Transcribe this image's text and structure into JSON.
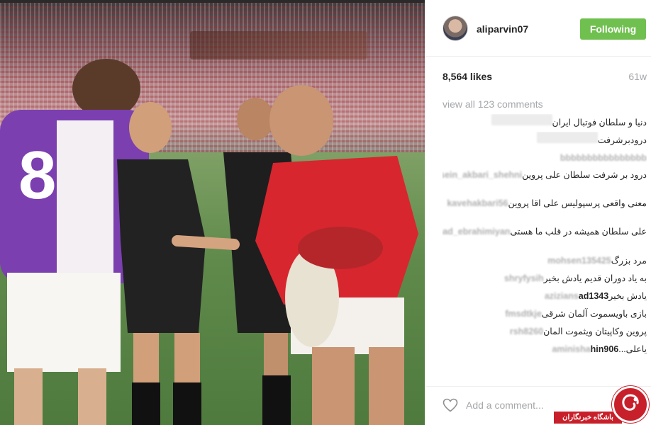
{
  "post": {
    "username": "aliparvin07",
    "follow_label": "Following",
    "likes": "8,564 likes",
    "age": "61w",
    "view_all": "view all 123 comments",
    "comment_placeholder": "Add a comment...",
    "photo_jersey_number": "8"
  },
  "comments": [
    {
      "user": "",
      "text": "دنیا و سلطان فوتبال ایران",
      "blank": true
    },
    {
      "user": "",
      "text": "درودبرشرفت",
      "blank": true
    },
    {
      "user": "bbbbbbbbbbbbbbbb",
      "text": "",
      "blank": false
    },
    {
      "user": "hossein_akbari_shehni",
      "text": "درود بر شرفت سلطان علی پروین",
      "two_line": true
    },
    {
      "user": "kavehakbari56",
      "text": "معنی واقعی پرسپولیس علی اقا پروین",
      "two_line": true
    },
    {
      "user": "mohamad_ebrahimiyan",
      "text": "علی سلطان همیشه در قلب ما هستی",
      "two_line": true
    },
    {
      "user": "mohsen135425",
      "text": "مرد بزرگ"
    },
    {
      "user": "shryfysih",
      "text": "به یاد دوران قدیم یادش بخیر"
    },
    {
      "user": "azizians",
      "user_clear": "ad1343",
      "text": "یادش بخیر"
    },
    {
      "user": "fmsdtkje",
      "text": "بازی باویسموت آلمان شرقی"
    },
    {
      "user": "rsh8260",
      "text": "پروین وکاپیتان ویثموت المان"
    },
    {
      "user": "aminisha",
      "user_clear": "hin906",
      "text": "یاعلی..."
    }
  ],
  "watermark": {
    "label": "باشگاه خبرنگاران"
  },
  "icons": {
    "like": "heart-icon",
    "watermark_logo": "club-logo-icon"
  },
  "colors": {
    "follow_button": "#70c050",
    "text": "#262626",
    "muted": "#a5a7aa",
    "watermark": "#c8202a"
  }
}
